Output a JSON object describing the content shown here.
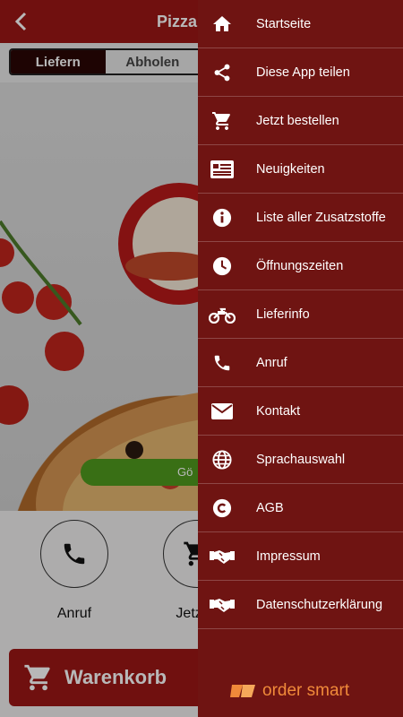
{
  "app": {
    "title": "Pizza",
    "tabs": [
      {
        "label": "Liefern"
      },
      {
        "label": "Abholen"
      }
    ],
    "order_pill": "Gö",
    "quick_actions": [
      {
        "label": "Anruf"
      },
      {
        "label": "Jetzt b"
      }
    ],
    "cart_label": "Warenkorb"
  },
  "drawer": {
    "items": [
      {
        "label": "Startseite",
        "icon": "home-icon"
      },
      {
        "label": "Diese App teilen",
        "icon": "share-icon"
      },
      {
        "label": "Jetzt bestellen",
        "icon": "cart-icon"
      },
      {
        "label": "Neuigkeiten",
        "icon": "news-icon"
      },
      {
        "label": "Liste aller Zusatzstoffe",
        "icon": "info-icon"
      },
      {
        "label": "Öffnungszeiten",
        "icon": "clock-icon"
      },
      {
        "label": "Lieferinfo",
        "icon": "motorcycle-icon"
      },
      {
        "label": "Anruf",
        "icon": "phone-icon"
      },
      {
        "label": "Kontakt",
        "icon": "mail-icon"
      },
      {
        "label": "Sprachauswahl",
        "icon": "globe-icon"
      },
      {
        "label": "AGB",
        "icon": "copyright-icon"
      },
      {
        "label": "Impressum",
        "icon": "handshake-icon"
      },
      {
        "label": "Datenschutzerklärung",
        "icon": "handshake-icon"
      }
    ],
    "brand": "order smart"
  },
  "colors": {
    "header": "#9c1716",
    "drawer": "#6f1412",
    "accent_green": "#4f9a1e",
    "brand_orange": "#f08a3a"
  }
}
